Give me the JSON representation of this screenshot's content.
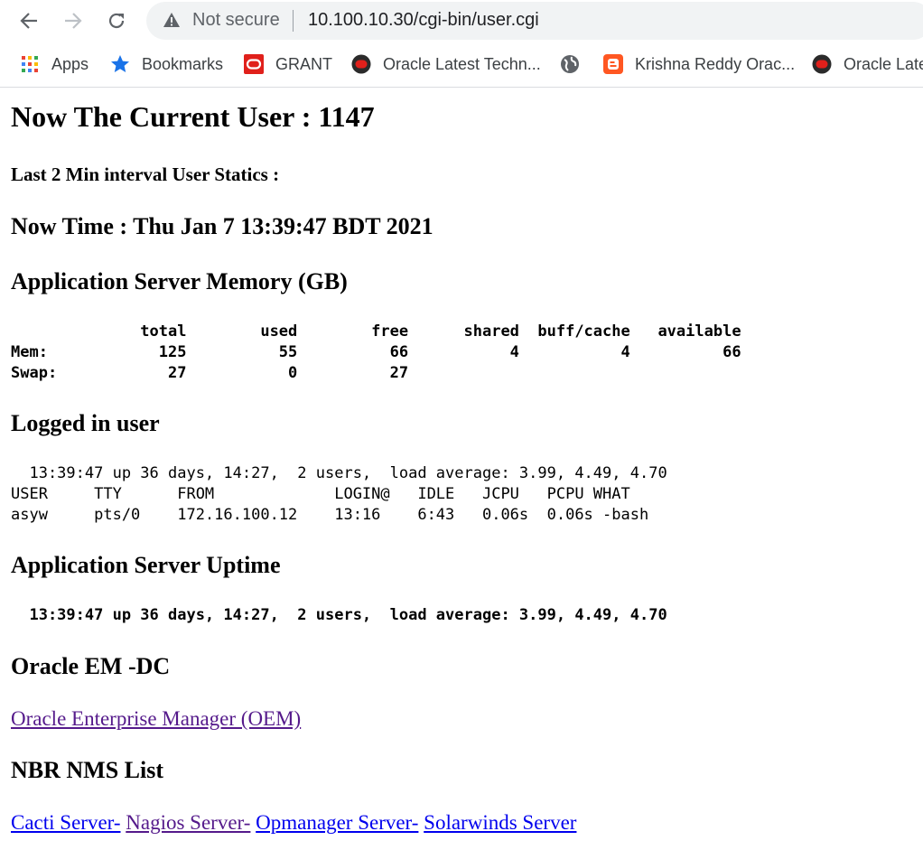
{
  "browser": {
    "security_label": "Not secure",
    "url": "10.100.10.30/cgi-bin/user.cgi",
    "bookmarks": [
      {
        "label": "Apps",
        "icon": "apps-grid-icon"
      },
      {
        "label": "Bookmarks",
        "icon": "star-icon"
      },
      {
        "label": "GRANT",
        "icon": "oracle-red-icon"
      },
      {
        "label": "Oracle Latest Techn...",
        "icon": "oracle-dark-icon"
      },
      {
        "label": "",
        "icon": "globe-icon"
      },
      {
        "label": "Krishna Reddy Orac...",
        "icon": "blogger-icon"
      },
      {
        "label": "Oracle Late",
        "icon": "oracle-dark-icon"
      }
    ]
  },
  "page": {
    "current_user_heading": "Now The Current User : 1147",
    "interval_heading": "Last 2 Min interval User Statics :",
    "time_heading": "Now Time : Thu Jan 7 13:39:47 BDT 2021",
    "memory_heading": "Application Server Memory (GB)",
    "memory_table": "              total        used        free      shared  buff/cache   available\nMem:            125          55          66           4           4          66\nSwap:            27           0          27",
    "logged_heading": "Logged in user",
    "logged_output": "  13:39:47 up 36 days, 14:27,  2 users,  load average: 3.99, 4.49, 4.70\nUSER     TTY      FROM             LOGIN@   IDLE   JCPU   PCPU WHAT\nasyw     pts/0    172.16.100.12    13:16    6:43   0.06s  0.06s -bash",
    "uptime_heading": "Application Server Uptime",
    "uptime_output": "  13:39:47 up 36 days, 14:27,  2 users,  load average: 3.99, 4.49, 4.70",
    "oem_heading": "Oracle EM -DC",
    "oem_link": "Oracle Enterprise Manager (OEM)",
    "nms_heading": "NBR NMS List",
    "nms_links": [
      "Cacti Server-",
      "Nagios Server-",
      "Opmanager Server-",
      "Solarwinds Server"
    ]
  },
  "colors": {
    "link": "#0000ee",
    "visited_link": "#551a8b"
  }
}
